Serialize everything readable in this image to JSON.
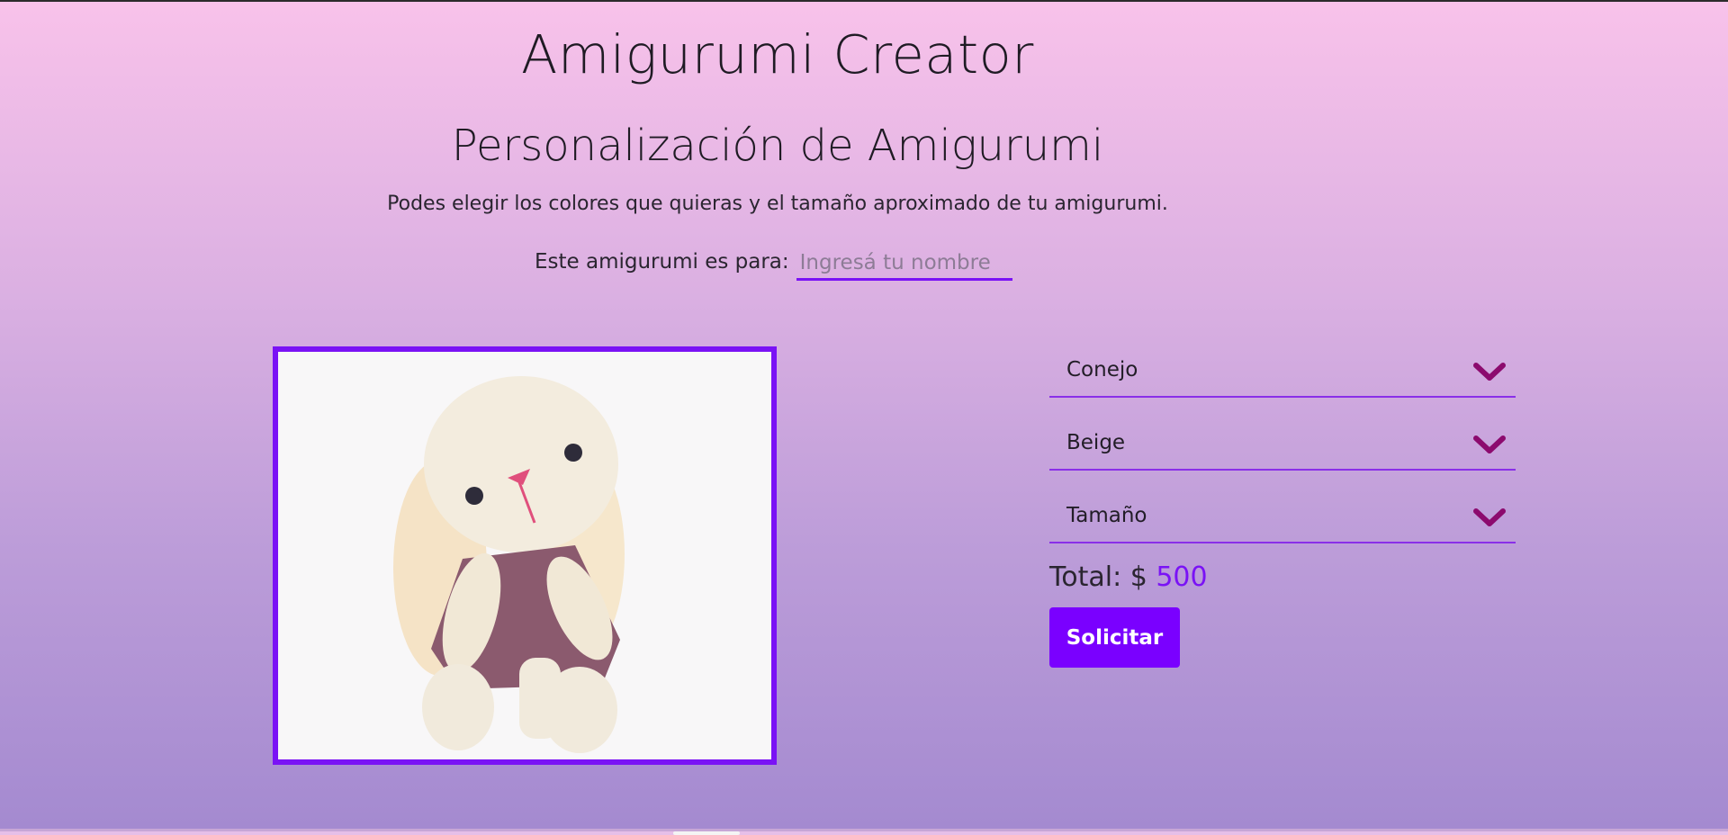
{
  "header": {
    "app_title": "Amigurumi Creator",
    "page_title": "Personalización de Amigurumi",
    "subtitle": "Podes elegir los colores que quieras y el tamaño aproximado de tu amigurumi."
  },
  "recipient": {
    "label": "Este amigurumi es para:",
    "placeholder": "Ingresá tu nombre",
    "value": ""
  },
  "options": {
    "model": "Conejo",
    "color": "Beige",
    "size": "Tamaño"
  },
  "total": {
    "label": "Total: $",
    "amount": "500"
  },
  "actions": {
    "submit_label": "Solicitar"
  },
  "colors": {
    "accent": "#7a12f5",
    "button": "#7a00ff",
    "chevron": "#8c0a6e"
  },
  "icons": {
    "dropdown": "chevron-down-icon"
  }
}
